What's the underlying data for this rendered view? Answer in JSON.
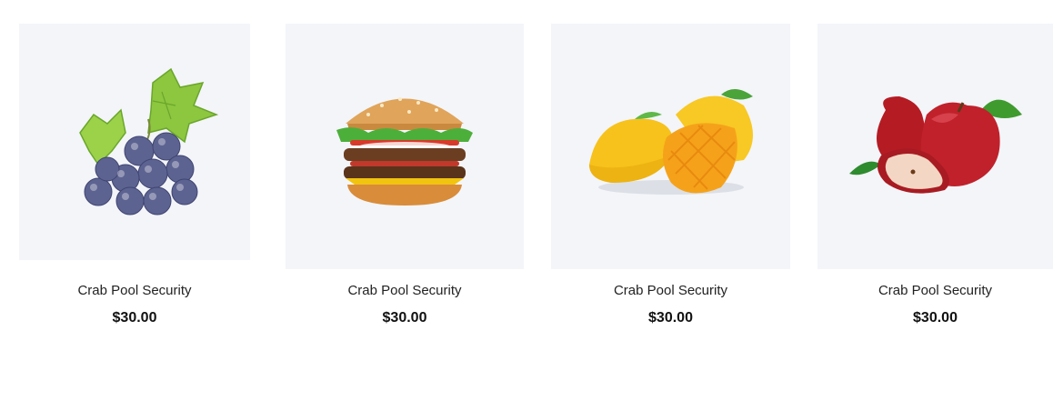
{
  "products": [
    {
      "title": "Crab Pool Security",
      "price": "$30.00",
      "image_icon": "grapes-icon"
    },
    {
      "title": "Crab Pool Security",
      "price": "$30.00",
      "image_icon": "burger-icon"
    },
    {
      "title": "Crab Pool Security",
      "price": "$30.00",
      "image_icon": "mango-icon"
    },
    {
      "title": "Crab Pool Security",
      "price": "$30.00",
      "image_icon": "apple-icon"
    }
  ],
  "colors": {
    "thumb_background": "#f3f5f9",
    "title_text": "#222222",
    "price_text": "#111111"
  }
}
